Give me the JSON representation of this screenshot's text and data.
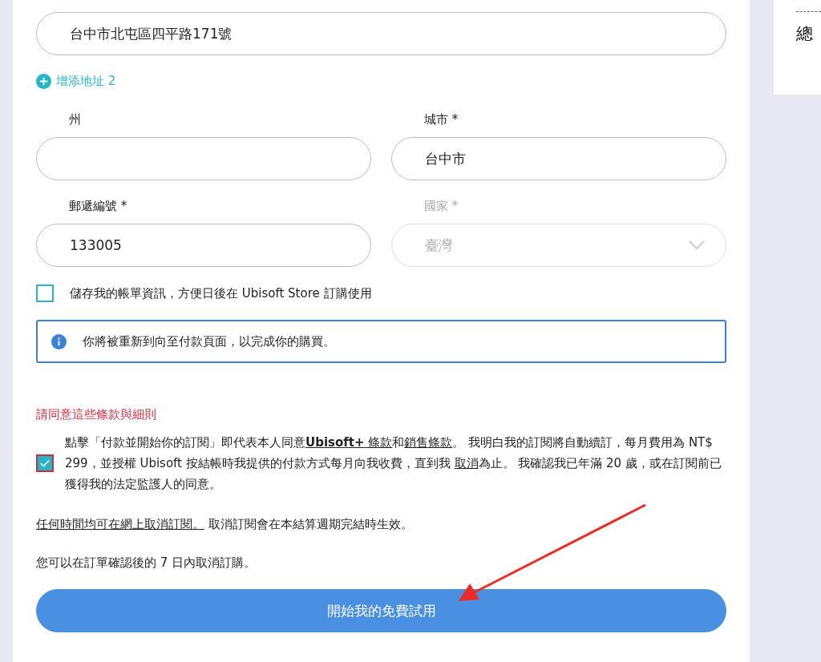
{
  "address_line_1": {
    "value": "台中市北屯區四平路171號"
  },
  "add_address_2": {
    "label": "增添地址 2"
  },
  "field_rows": [
    {
      "fields": [
        {
          "label": "州",
          "kind": "text",
          "disabled": false
        },
        {
          "label": "城市 *",
          "value": "台中市",
          "kind": "text",
          "disabled": false
        }
      ]
    },
    {
      "fields": [
        {
          "label": "郵遞編號 *",
          "value": "133005",
          "kind": "text",
          "disabled": false
        },
        {
          "label": "國家 *",
          "value": "臺灣",
          "kind": "select",
          "disabled": true
        }
      ]
    }
  ],
  "save_billing": {
    "label": "儲存我的帳單資訊，方便日後在 Ubisoft Store 訂購使用",
    "checked": false
  },
  "info_notice": {
    "text": "你將被重新到向至付款頁面，以完成你的購買。"
  },
  "terms": {
    "heading": "請同意這些條款與細則",
    "checked": true,
    "segments": [
      {
        "kind": "plain",
        "text": "點擊「付款並開始你的訂閱」即代表本人同意"
      },
      {
        "kind": "link",
        "text": "**Ubisoft+** 條款"
      },
      {
        "kind": "plain",
        "text": "和"
      },
      {
        "kind": "link",
        "text": "銷售條款"
      },
      {
        "kind": "plain",
        "text": "。 我明白我的訂閱將自動續訂，每月費用為 NT$ 299，並授權 Ubisoft 按結帳時我提供的付款方式每月向我收費，直到我 "
      },
      {
        "kind": "link",
        "text": "取消"
      },
      {
        "kind": "plain",
        "text": "為止。 我確認我已年滿 20 歲，或在訂閱前已獲得我的法定監護人的同意。"
      }
    ]
  },
  "cancel_note": {
    "link": "任何時間均可在網上取消訂閱。",
    "text": " 取消訂閱會在本結算週期完結時生效。"
  },
  "refund_note": {
    "text": "您可以在訂單確認後的 7 日內取消訂購。"
  },
  "submit_button": {
    "label": "開始我的免費試用"
  },
  "summary": {
    "total_label": "總"
  }
}
